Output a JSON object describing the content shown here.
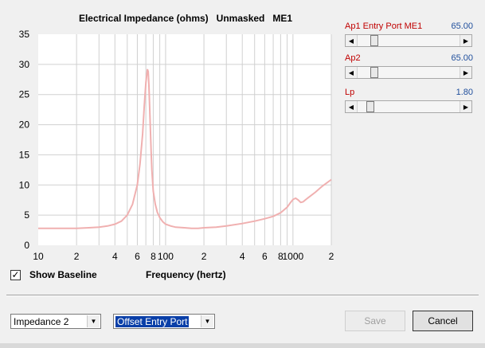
{
  "chart_data": {
    "type": "line",
    "title": "Electrical Impedance (ohms)   Unmasked   ME1",
    "xlabel": "Frequency (hertz)",
    "x_scale": "log",
    "xlim": [
      10,
      2000
    ],
    "ylim": [
      0,
      35
    ],
    "y_ticks": [
      "0",
      "5",
      "10",
      "15",
      "20",
      "25",
      "30",
      "35"
    ],
    "x_ticks": [
      "10",
      "2",
      "4",
      "6",
      "8",
      "100",
      "2",
      "4",
      "6",
      "8",
      "1000",
      "2"
    ],
    "grid": true,
    "series": [
      {
        "color": "#f0b0b0",
        "x": [
          10,
          15,
          20,
          25,
          30,
          35,
          40,
          45,
          50,
          55,
          60,
          63,
          66,
          68,
          70,
          72,
          73,
          74,
          75,
          76,
          77,
          78,
          80,
          83,
          86,
          90,
          95,
          100,
          110,
          120,
          140,
          160,
          180,
          200,
          250,
          300,
          400,
          500,
          600,
          700,
          800,
          900,
          950,
          1000,
          1050,
          1100,
          1150,
          1200,
          1300,
          1500,
          1700,
          2000
        ],
        "values": [
          2.8,
          2.8,
          2.8,
          2.9,
          3.0,
          3.2,
          3.5,
          4.0,
          5.0,
          6.8,
          10.0,
          13.5,
          18.5,
          23.0,
          27.0,
          29.2,
          28.8,
          26.5,
          23.0,
          19.0,
          15.5,
          12.5,
          9.0,
          6.8,
          5.5,
          4.6,
          3.9,
          3.5,
          3.2,
          3.0,
          2.9,
          2.8,
          2.8,
          2.9,
          3.0,
          3.2,
          3.6,
          4.0,
          4.4,
          4.8,
          5.4,
          6.3,
          7.0,
          7.6,
          7.8,
          7.5,
          7.1,
          7.2,
          7.8,
          8.8,
          9.8,
          10.9
        ]
      }
    ]
  },
  "sliders": [
    {
      "label": "Ap1  Entry Port  ME1",
      "value": "65.00",
      "level": 0.14
    },
    {
      "label": "Ap2",
      "value": "65.00",
      "level": 0.14
    },
    {
      "label": "Lp",
      "value": "1.80",
      "level": 0.1
    }
  ],
  "show_baseline": {
    "label": "Show Baseline",
    "checked": true,
    "mark": "✓"
  },
  "dropdowns": {
    "impedance": {
      "value": "Impedance 2"
    },
    "offset": {
      "value": "Offset Entry Port"
    }
  },
  "buttons": {
    "save": "Save",
    "cancel": "Cancel"
  },
  "icons": {
    "left": "◀",
    "right": "▶",
    "down": "▼"
  }
}
